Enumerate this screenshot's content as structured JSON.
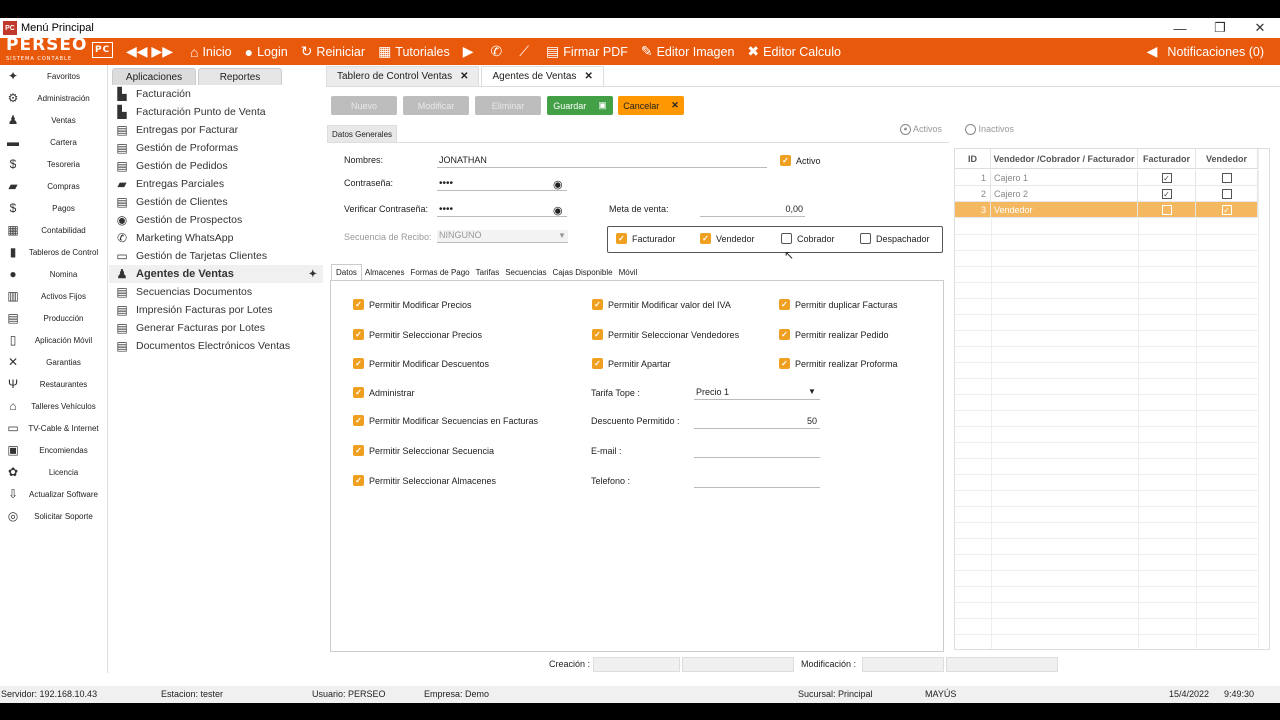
{
  "window": {
    "title": "Menú Principal",
    "app_icon": "PC"
  },
  "toolbar": {
    "logo": "PERSEO",
    "logo_sub": "SISTEMA CONTABLE",
    "logo_pc": "PC",
    "items": [
      {
        "label": "Inicio",
        "icon": "home-icon"
      },
      {
        "label": "Login",
        "icon": "user-icon"
      },
      {
        "label": "Reiniciar",
        "icon": "refresh-icon"
      },
      {
        "label": "Tutoriales",
        "icon": "tutorial-icon"
      },
      {
        "label": "",
        "icon": "youtube-icon"
      },
      {
        "label": "",
        "icon": "whatsapp-icon"
      },
      {
        "label": "",
        "icon": "chart-icon"
      },
      {
        "label": "Firmar PDF",
        "icon": "pdf-icon"
      },
      {
        "label": "Editor Imagen",
        "icon": "image-edit-icon"
      },
      {
        "label": "Editor Calculo",
        "icon": "excel-icon"
      }
    ],
    "notifications": "Notificaciones (0)"
  },
  "sidebar": {
    "items": [
      "Favoritos",
      "Administración",
      "Ventas",
      "Cartera",
      "Tesoreria",
      "Compras",
      "Pagos",
      "Contabilidad",
      "Tableros de Control",
      "Nomina",
      "Activos Fijos",
      "Producción",
      "Aplicación Móvil",
      "Garantias",
      "Restaurantes",
      "Talleres Vehículos",
      "TV-Cable & Internet",
      "Encomiendas",
      "Licencia",
      "Actualizar Software",
      "Solicitar Soporte"
    ]
  },
  "menu": {
    "tabs": [
      "Aplicaciones",
      "Reportes"
    ],
    "items": [
      "Facturación",
      "Facturación Punto de Venta",
      "Entregas por Facturar",
      "Gestión de Proformas",
      "Gestión de Pedidos",
      "Entregas Parciales",
      "Gestión de Clientes",
      "Gestión de Prospectos",
      "Marketing WhatsApp",
      "Gestión de Tarjetas Clientes",
      "Agentes de Ventas",
      "Secuencias Documentos",
      "Impresión Facturas por Lotes",
      "Generar Facturas por Lotes",
      "Documentos Electrónicos Ventas"
    ]
  },
  "doc_tabs": [
    "Tablero de Control Ventas",
    "Agentes de Ventas"
  ],
  "actions": {
    "nuevo": "Nuevo",
    "modificar": "Modificar",
    "eliminar": "Eliminar",
    "guardar": "Guardar",
    "cancelar": "Cancelar"
  },
  "filter": {
    "activos": "Activos",
    "inactivos": "Inactivos"
  },
  "section": "Datos Generales",
  "form": {
    "nombres_label": "Nombres:",
    "nombres": "JONATHAN",
    "pass_label": "Contraseña:",
    "pass": "••••",
    "verify_label": "Verificar Contraseña:",
    "verify": "••••",
    "seq_label": "Secuencia de Recibo:",
    "seq": "NINGUNO",
    "activo": "Activo",
    "meta_label": "Meta de venta:",
    "meta": "0,00",
    "roles": [
      {
        "label": "Facturador",
        "checked": true
      },
      {
        "label": "Vendedor",
        "checked": true
      },
      {
        "label": "Cobrador",
        "checked": false
      },
      {
        "label": "Despachador",
        "checked": false
      }
    ]
  },
  "subtabs": [
    "Datos",
    "Almacenes",
    "Formas de Pago",
    "Tarifas",
    "Secuencias",
    "Cajas Disponible",
    "Móvil"
  ],
  "perms_col1": [
    "Permitir Modificar Precios",
    "Permitir Seleccionar Precios",
    "Permitir Modificar Descuentos",
    "Administrar",
    "Permitir Modificar Secuencias en Facturas",
    "Permitir Seleccionar Secuencia",
    "Permitir Seleccionar Almacenes"
  ],
  "perms_col2": [
    "Permitir Modificar valor del IVA",
    "Permitir Seleccionar Vendedores",
    "Permitir Apartar"
  ],
  "perms_col3": [
    "Permitir duplicar Facturas",
    "Permitir realizar Pedido",
    "Permitir realizar Proforma"
  ],
  "extra": {
    "tarifa_label": "Tarifa Tope :",
    "tarifa": "Precio 1",
    "desc_label": "Descuento Permitido :",
    "desc": "50",
    "email_label": "E-mail :",
    "tel_label": "Telefono :"
  },
  "grid": {
    "headers": [
      "ID",
      "Vendedor /Cobrador / Facturador",
      "Facturador",
      "Vendedor"
    ],
    "rows": [
      {
        "id": "1",
        "name": "Cajero 1",
        "fact": true,
        "vend": false
      },
      {
        "id": "2",
        "name": "Cajero 2",
        "fact": true,
        "vend": false
      },
      {
        "id": "3",
        "name": "Vendedor",
        "fact": false,
        "vend": true
      }
    ]
  },
  "audit": {
    "creacion": "Creación :",
    "modificacion": "Modificación :"
  },
  "status": {
    "servidor": "Servidor: 192.168.10.43",
    "estacion": "Estacion: tester",
    "usuario": "Usuario: PERSEO",
    "empresa": "Empresa: Demo",
    "sucursal": "Sucursal: Principal",
    "mayus": "MAYÚS",
    "fecha": "15/4/2022",
    "hora": "9:49:30"
  },
  "colors": {
    "accent": "#e8590c",
    "check": "#f0a020",
    "save": "#43a047",
    "cancel": "#ff9800"
  }
}
